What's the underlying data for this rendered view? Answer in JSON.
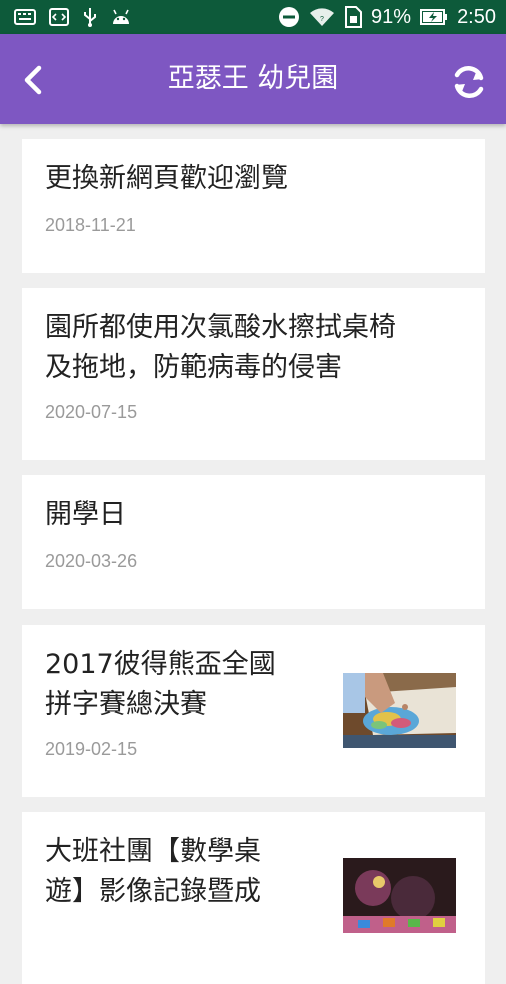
{
  "status_bar": {
    "battery_percent": "91%",
    "time": "2:50",
    "icons": [
      "keyboard-icon",
      "code-icon",
      "usb-icon",
      "android-icon",
      "do-not-disturb-icon",
      "wifi-icon",
      "sim-icon",
      "battery-charging-icon"
    ]
  },
  "app_bar": {
    "title": "亞瑟王 幼兒園",
    "back_icon": "back-chevron-icon",
    "refresh_icon": "refresh-icon",
    "color": "#7e57c2"
  },
  "news": [
    {
      "title_lines": [
        "更換新網頁歡迎瀏覽"
      ],
      "date": "2018-11-21"
    },
    {
      "title_lines": [
        "園所都使用次氯酸水擦拭桌椅",
        "及拖地，防範病毒的侵害"
      ],
      "date": "2020-07-15"
    },
    {
      "title_lines": [
        "開學日"
      ],
      "date": "2020-03-26"
    },
    {
      "title_lines": [
        "2017彼得熊盃全國",
        "拼字賽總決賽"
      ],
      "date": "2019-02-15",
      "has_image": true
    },
    {
      "title_lines": [
        "大班社團【數學桌",
        "遊】影像記錄暨成"
      ],
      "date": "",
      "has_image": true
    }
  ]
}
